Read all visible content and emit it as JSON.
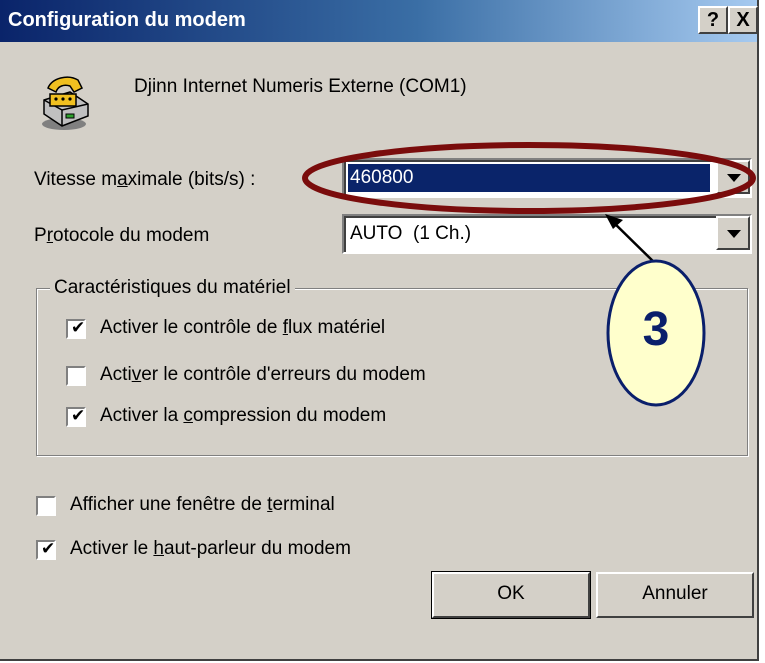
{
  "window": {
    "title": "Configuration du modem",
    "help_label": "?",
    "close_label": "X"
  },
  "device": {
    "icon": "modem-phone-icon",
    "name": "Djinn Internet Numeris Externe (COM1)"
  },
  "speed": {
    "label_pre": "Vitesse m",
    "label_u": "a",
    "label_post": "ximale (bits/s) :",
    "value": "460800"
  },
  "protocol": {
    "label_pre": "P",
    "label_u": "r",
    "label_post": "otocole du modem",
    "value": "AUTO  (1 Ch.)"
  },
  "hardware": {
    "legend": "Caractéristiques du matériel",
    "flow": {
      "pre": "Activer le contrôle de ",
      "u": "f",
      "post": "lux matériel",
      "checked": true
    },
    "error": {
      "pre": "Acti",
      "u": "v",
      "post": "er le contrôle d'erreurs du modem",
      "checked": false
    },
    "compress": {
      "pre": "Activer la ",
      "u": "c",
      "post": "ompression du modem",
      "checked": true
    }
  },
  "terminal": {
    "pre": "Afficher une fenêtre de ",
    "u": "t",
    "post": "erminal",
    "checked": false
  },
  "speaker": {
    "pre": "Activer le ",
    "u": "h",
    "post": "aut-parleur du modem",
    "checked": true
  },
  "buttons": {
    "ok": "OK",
    "cancel": "Annuler"
  },
  "checkmark": "✔",
  "annotation": {
    "number": "3",
    "ring_color": "#7a0c0c",
    "bubble_color": "#ffffcc"
  }
}
